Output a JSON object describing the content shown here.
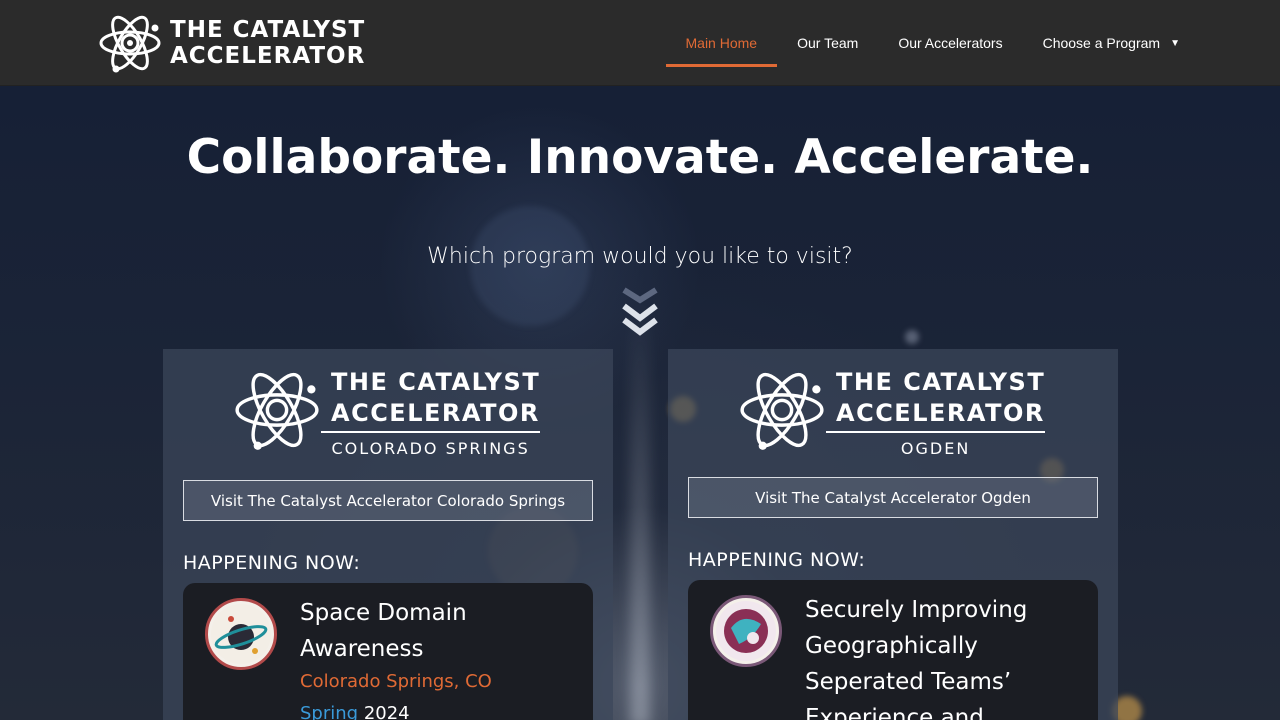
{
  "header": {
    "logo_line1": "THE CATALYST",
    "logo_line2": "ACCELERATOR",
    "nav": [
      {
        "label": "Main Home",
        "active": true
      },
      {
        "label": "Our Team"
      },
      {
        "label": "Our Accelerators"
      },
      {
        "label": "Choose a Program"
      }
    ]
  },
  "hero": {
    "title": "Collaborate. Innovate. Accelerate.",
    "subtitle": "Which program would you like to visit?"
  },
  "cards": {
    "cs": {
      "logo_line1": "THE CATALYST",
      "logo_line2": "ACCELERATOR",
      "location_tag": "COLORADO SPRINGS",
      "visit_label": "Visit The Catalyst Accelerator Colorado Springs",
      "happening_label": "HAPPENING NOW:",
      "program": {
        "title": "Space Domain Awareness",
        "location": "Colorado Springs, CO",
        "season": "Spring",
        "year": "2024"
      }
    },
    "og": {
      "logo_line1": "THE CATALYST",
      "logo_line2": "ACCELERATOR",
      "location_tag": "OGDEN",
      "visit_label": "Visit The Catalyst Accelerator Ogden",
      "happening_label": "HAPPENING NOW:",
      "program": {
        "title": "Securely Improving Geographically Seperated Teams’ Experience and"
      }
    }
  },
  "colors": {
    "accent": "#e06a35",
    "header_bg": "#2b2b2b",
    "season_blue": "#3a9ad9"
  },
  "icons": {
    "logo": "atom-icon",
    "scroll": "double-chevron-down-icon",
    "dropdown": "caret-down-icon"
  }
}
